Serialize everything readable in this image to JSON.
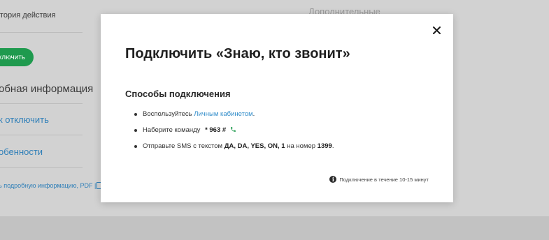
{
  "background": {
    "history_text": "тория действия",
    "right_title": "Дополнительные",
    "connect_button": "ключить",
    "detail_heading": "обная информация",
    "link_disconnect": "к отключить",
    "link_features": "обенности",
    "pdf_text": "ь подробную информацию, PDF |"
  },
  "modal": {
    "title": "Подключить «Знаю, кто звонит»",
    "subtitle": "Способы подключения",
    "methods": {
      "m1_text": "Воспользуйтесь",
      "m1_link": "Личным кабинетом",
      "m1_end": ".",
      "m2_text": "Наберите команду",
      "m2_cmd": "* 963 #",
      "m3_text": "Отправьте SMS с текстом",
      "m3_bold": "ДА, DA, YES, ON, 1",
      "m3_mid": "на номер",
      "m3_number": "1399",
      "m3_end": "."
    },
    "note": "Подключение в течение 10-15 минут",
    "close_icon": "close-icon",
    "phone_icon": "phone-icon",
    "info_icon": "info-icon"
  },
  "colors": {
    "link": "#2e8bc9",
    "button_green": "#1f9a4e",
    "phone_green": "#1f9a4e"
  }
}
